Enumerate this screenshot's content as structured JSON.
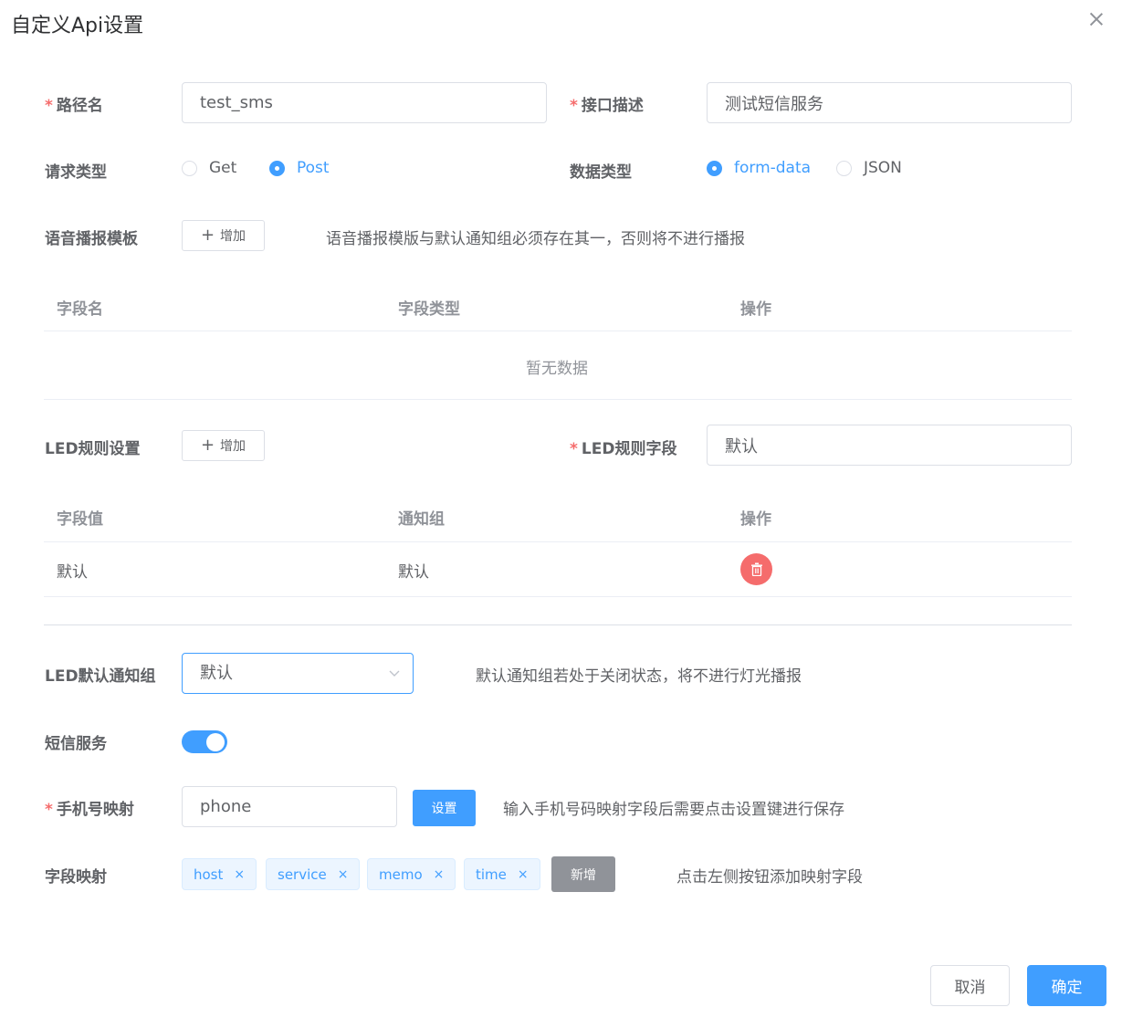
{
  "dialog": {
    "title": "自定义Api设置"
  },
  "path_name": {
    "label": "路径名",
    "value": "test_sms"
  },
  "interface_desc": {
    "label": "接口描述",
    "value": "测试短信服务"
  },
  "request_type": {
    "label": "请求类型",
    "options": [
      "Get",
      "Post"
    ],
    "selected": "Post"
  },
  "data_type": {
    "label": "数据类型",
    "options": [
      "form-data",
      "JSON"
    ],
    "selected": "form-data"
  },
  "voice_template": {
    "label": "语音播报模板",
    "add_label": "增加",
    "hint": "语音播报模版与默认通知组必须存在其一，否则将不进行播报",
    "columns": [
      "字段名",
      "字段类型",
      "操作"
    ],
    "empty_text": "暂无数据"
  },
  "led_rule": {
    "label": "LED规则设置",
    "add_label": "增加",
    "field_label": "LED规则字段",
    "field_value": "默认",
    "columns": [
      "字段值",
      "通知组",
      "操作"
    ],
    "rows": [
      {
        "value": "默认",
        "group": "默认"
      }
    ]
  },
  "led_default_group": {
    "label": "LED默认通知组",
    "selected": "默认",
    "hint": "默认通知组若处于关闭状态，将不进行灯光播报"
  },
  "sms_service": {
    "label": "短信服务",
    "enabled": true
  },
  "phone_mapping": {
    "label": "手机号映射",
    "value": "phone",
    "set_label": "设置",
    "hint": "输入手机号码映射字段后需要点击设置键进行保存"
  },
  "field_mapping": {
    "label": "字段映射",
    "tags": [
      "host",
      "service",
      "memo",
      "time"
    ],
    "add_label": "新增",
    "hint": "点击左侧按钮添加映射字段"
  },
  "footer": {
    "cancel_label": "取消",
    "confirm_label": "确定"
  },
  "colors": {
    "primary": "#409eff",
    "danger": "#f56c6c",
    "gray": "#909399"
  }
}
